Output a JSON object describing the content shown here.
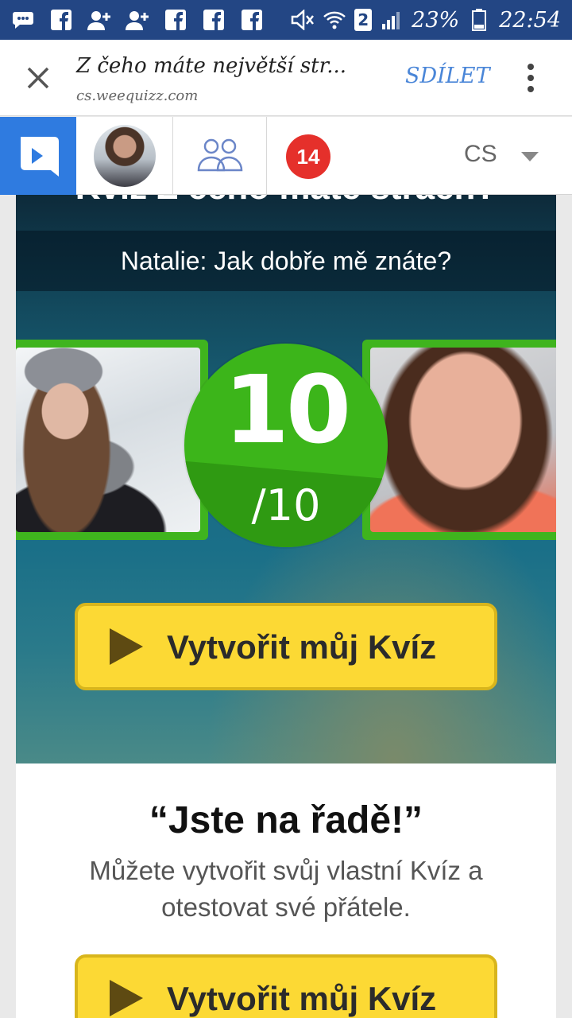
{
  "status_bar": {
    "battery": "23%",
    "time": "22:54",
    "sim_slot": "2",
    "icons": [
      "messages-icon",
      "facebook-icon",
      "add-friend-icon",
      "add-friend-icon",
      "facebook-icon",
      "facebook-icon",
      "facebook-icon",
      "mute-icon",
      "wifi-icon",
      "sim-icon",
      "signal-icon",
      "battery-icon"
    ]
  },
  "browser": {
    "title": "Z čeho máte největší str...",
    "url": "cs.weequizz.com",
    "share_label": "SDÍLET"
  },
  "nav": {
    "notification_count": "14",
    "language": "CS"
  },
  "quiz": {
    "cut_title": "Kvíz Z čeho máte strach?",
    "subtitle": "Natalie: Jak dobře mě znáte?",
    "score": "10",
    "score_total": "/10",
    "cta_label": "Vytvořit můj Kvíz"
  },
  "promo": {
    "heading": "“Jste na řadě!”",
    "description": "Můžete vytvořit svůj vlastní Kvíz a otestovat své přátele.",
    "cta_label": "Vytvořit můj Kvíz"
  },
  "colors": {
    "status_bar": "#234684",
    "logo_blue": "#2f7be0",
    "score_green": "#3cb51a",
    "cta_yellow": "#fcd934",
    "badge_red": "#e5302b",
    "share_blue": "#4a86d8"
  }
}
